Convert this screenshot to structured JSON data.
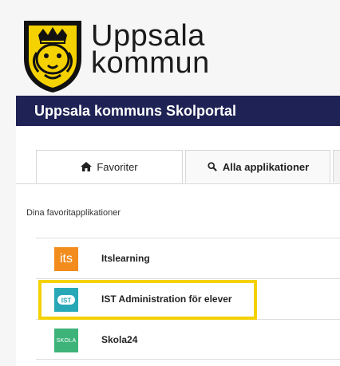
{
  "brand": {
    "line1": "Uppsala",
    "line2": "kommun",
    "crest_icon": "lion-crown-crest-icon",
    "crest_color": "#f4d100"
  },
  "header": {
    "title": "Uppsala kommuns Skolportal",
    "bg_color": "#1f2255"
  },
  "tabs": [
    {
      "label": "Favoriter",
      "icon": "home-icon",
      "active": true
    },
    {
      "label": "Alla applikationer",
      "icon": "search-icon",
      "active": false
    }
  ],
  "favorites": {
    "section_label": "Dina favoritapplikationer",
    "apps": [
      {
        "name": "Itslearning",
        "icon_text": "its",
        "icon_color": "#f28c1c"
      },
      {
        "name": "IST Administration för elever",
        "icon_text": "IST",
        "icon_color": "#28a8b7",
        "highlighted": true
      },
      {
        "name": "Skola24",
        "icon_text": "SKOLA",
        "icon_color": "#3db37a"
      }
    ]
  },
  "highlight_color": "#f4d100"
}
